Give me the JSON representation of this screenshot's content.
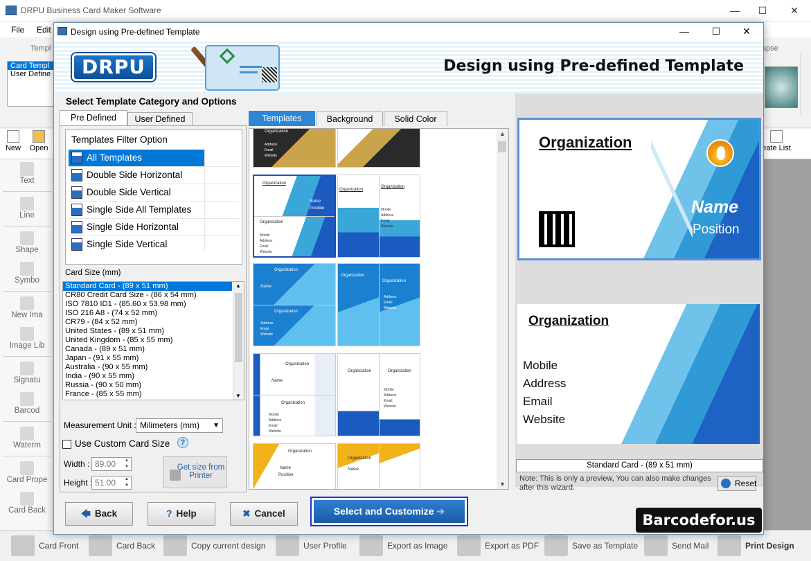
{
  "app": {
    "title": "DRPU Business Card Maker Software",
    "menu": [
      "File",
      "Edit"
    ],
    "ribbon_label_left": "Templ",
    "ribbon_label_right": "apse",
    "template_list": [
      "Card Templ",
      "User Define"
    ],
    "toolbar": {
      "new": "New",
      "open": "Open",
      "create_list": "eate List"
    },
    "left_tools": [
      "Text",
      "Line",
      "Shape",
      "Symbo",
      "New Ima",
      "Image Lib",
      "Signatu",
      "Barcod",
      "Waterm",
      "Card Prope",
      "Card Back"
    ],
    "bottom_bar": [
      "Card Front",
      "Card Back",
      "Copy current design",
      "User Profile",
      "Export as Image",
      "Export as PDF",
      "Save as Template",
      "Send Mail",
      "Print Design"
    ]
  },
  "dialog": {
    "title": "Design using Pre-defined Template",
    "banner_logo": "DRPU",
    "banner_title": "Design using Pre-defined Template",
    "section_title": "Select Template Category and Options",
    "tabs_left": [
      "Pre Defined",
      "User Defined"
    ],
    "filter": {
      "header": "Templates Filter Option",
      "items": [
        "All Templates",
        "Double Side Horizontal",
        "Double Side Vertical",
        "Single Side All Templates",
        "Single Side Horizontal",
        "Single Side Vertical"
      ]
    },
    "card_size": {
      "label": "Card Size (mm)",
      "items": [
        "Standard Card  -   (89 x 51 mm)",
        "CR80 Credit Card Size  -   (86 x 54 mm)",
        "ISO 7810 ID1  -   (85.60 x 53.98 mm)",
        "ISO 216  A8  -   (74 x 52 mm)",
        "CR79  -   (84 x 52 mm)",
        "United States  -   (89 x 51 mm)",
        "United Kingdom  -   (85 x 55 mm)",
        "Canada  -   (89 x 51 mm)",
        "Japan  -   (91 x 55 mm)",
        "Australia  -   (90 x 55 mm)",
        "India  -   (90 x 55 mm)",
        "Russia  -   (90 x 50 mm)",
        "France  -   (85 x 55 mm)"
      ]
    },
    "measurement": {
      "label": "Measurement Unit :",
      "value": "Milimeters (mm)"
    },
    "custom_size": {
      "label": "Use Custom Card Size",
      "help": "?"
    },
    "width": {
      "label": "Width :",
      "value": "89.00"
    },
    "height": {
      "label": "Height :",
      "value": "51.00"
    },
    "printer_button": "Get size from Printer",
    "tabs_right": [
      "Templates",
      "Background",
      "Solid Color"
    ],
    "thumb_text": {
      "org": "Organization",
      "name": "Name",
      "position": "Position",
      "lines": "Address\nEmail\nWebsite",
      "lines2": "Mobile\nAddress\nEmail\nWebsite"
    },
    "preview": {
      "front_org": "Organization",
      "front_name": "Name",
      "front_position": "Position",
      "back_org": "Organization",
      "back_lines": [
        "Mobile",
        "Address",
        "Email",
        "Website"
      ],
      "size_caption": "Standard Card  -   (89 x 51 mm)",
      "note": "Note: This is only a preview, You can also make changes after this wizard.",
      "reset": "Reset"
    },
    "buttons": {
      "back": "Back",
      "help": "Help",
      "cancel": "Cancel",
      "select": "Select and Customize"
    },
    "brand": "Barcodefor.us"
  }
}
